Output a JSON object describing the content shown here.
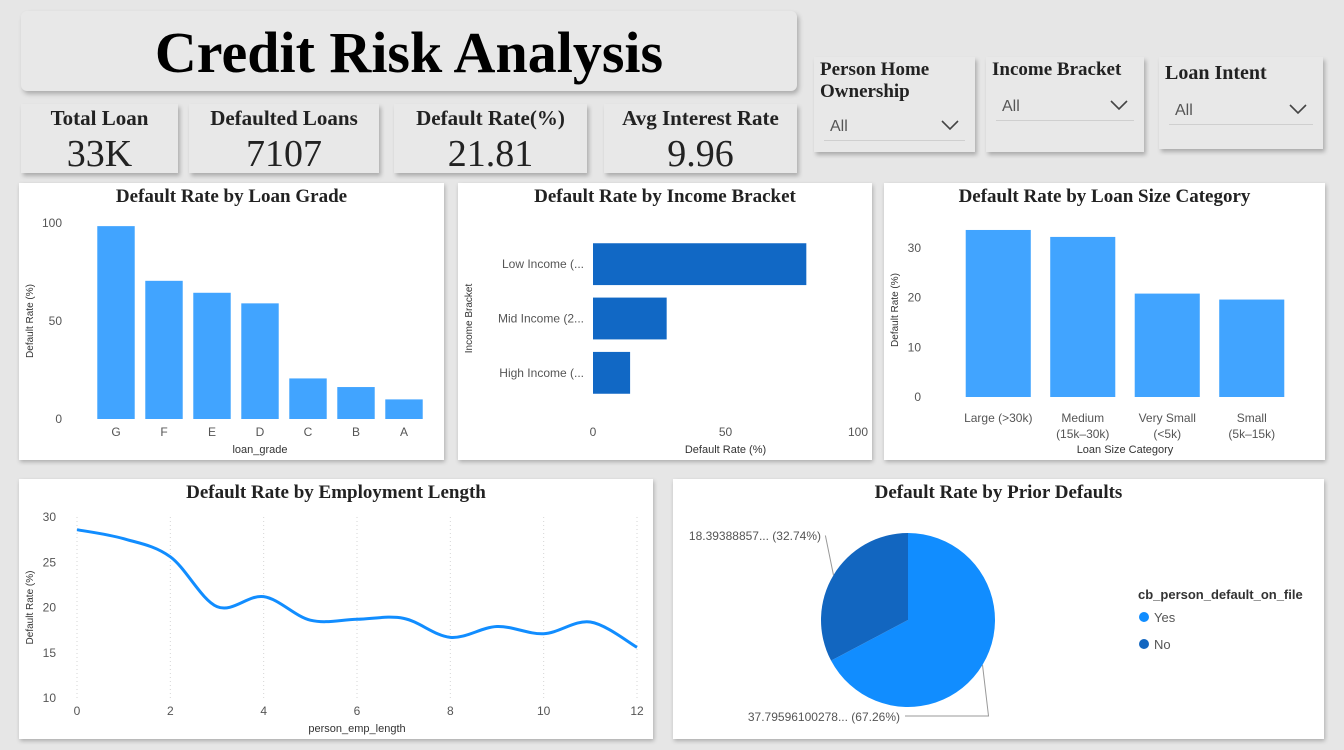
{
  "title": "Credit Risk Analysis",
  "kpis": [
    {
      "label": "Total Loan",
      "value": "33K"
    },
    {
      "label": "Defaulted Loans",
      "value": "7107"
    },
    {
      "label": "Default Rate(%)",
      "value": "21.81"
    },
    {
      "label": "Avg Interest Rate",
      "value": "9.96"
    }
  ],
  "slicers": [
    {
      "label_line1": "Person Home",
      "label_line2": "Ownership",
      "value": "All"
    },
    {
      "label_line1": "Income Bracket",
      "label_line2": "",
      "value": "All"
    },
    {
      "label_line1": "Loan Intent",
      "label_line2": "",
      "value": "All"
    }
  ],
  "colors": {
    "bar": "#41a4ff",
    "bar_dark": "#1168c5",
    "pie_yes": "#118dff",
    "pie_no": "#1266c0"
  },
  "chart_data": [
    {
      "type": "bar",
      "title": "Default Rate by Loan Grade",
      "categories": [
        "G",
        "F",
        "E",
        "D",
        "C",
        "B",
        "A"
      ],
      "values": [
        98.4,
        70.5,
        64.4,
        59.0,
        20.7,
        16.3,
        10.0
      ],
      "xlabel": "loan_grade",
      "ylabel": "Default Rate (%)",
      "ylim": [
        0,
        100
      ],
      "yticks": [
        "0",
        "50",
        "100"
      ]
    },
    {
      "type": "bar",
      "orientation": "horizontal",
      "title": "Default Rate by Income Bracket",
      "categories": [
        "Low Income (...",
        "Mid Income (2...",
        "High Income (..."
      ],
      "values": [
        80.5,
        27.8,
        14.0
      ],
      "xlabel": "Default Rate (%)",
      "ylabel": "Income Bracket",
      "xlim": [
        0,
        100
      ],
      "xticks": [
        "0",
        "50",
        "100"
      ]
    },
    {
      "type": "bar",
      "title": "Default Rate by Loan Size Category",
      "categories": [
        [
          "Large (>30k)"
        ],
        [
          "Medium",
          "(15k–30k)"
        ],
        [
          "Very Small",
          "(<5k)"
        ],
        [
          "Small",
          "(5k–15k)"
        ]
      ],
      "values": [
        33.6,
        32.2,
        20.8,
        19.6
      ],
      "xlabel": "Loan Size Category",
      "ylabel": "Default Rate (%)",
      "ylim": [
        0,
        35
      ],
      "yticks": [
        "0",
        "10",
        "20",
        "30"
      ]
    },
    {
      "type": "line",
      "title": "Default Rate by Employment Length",
      "x": [
        0,
        1,
        2,
        3,
        4,
        5,
        6,
        7,
        8,
        9,
        10,
        11,
        12
      ],
      "values": [
        28.6,
        27.6,
        25.6,
        20.1,
        21.2,
        18.6,
        18.7,
        18.8,
        16.7,
        17.9,
        17.1,
        18.4,
        15.6
      ],
      "xlabel": "person_emp_length",
      "ylabel": "Default Rate (%)",
      "xlim": [
        0,
        12
      ],
      "ylim": [
        10,
        30
      ],
      "xticks": [
        "0",
        "2",
        "4",
        "6",
        "8",
        "10",
        "12"
      ],
      "yticks": [
        "10",
        "15",
        "20",
        "25",
        "30"
      ]
    },
    {
      "type": "pie",
      "title": "Default Rate by Prior Defaults",
      "legend_title": "cb_person_default_on_file",
      "slices": [
        {
          "name": "Yes",
          "value": 37.79596100278,
          "label": "37.79596100278... (67.26%)"
        },
        {
          "name": "No",
          "value": 18.39388857,
          "label": "18.39388857... (32.74%)"
        }
      ]
    }
  ]
}
